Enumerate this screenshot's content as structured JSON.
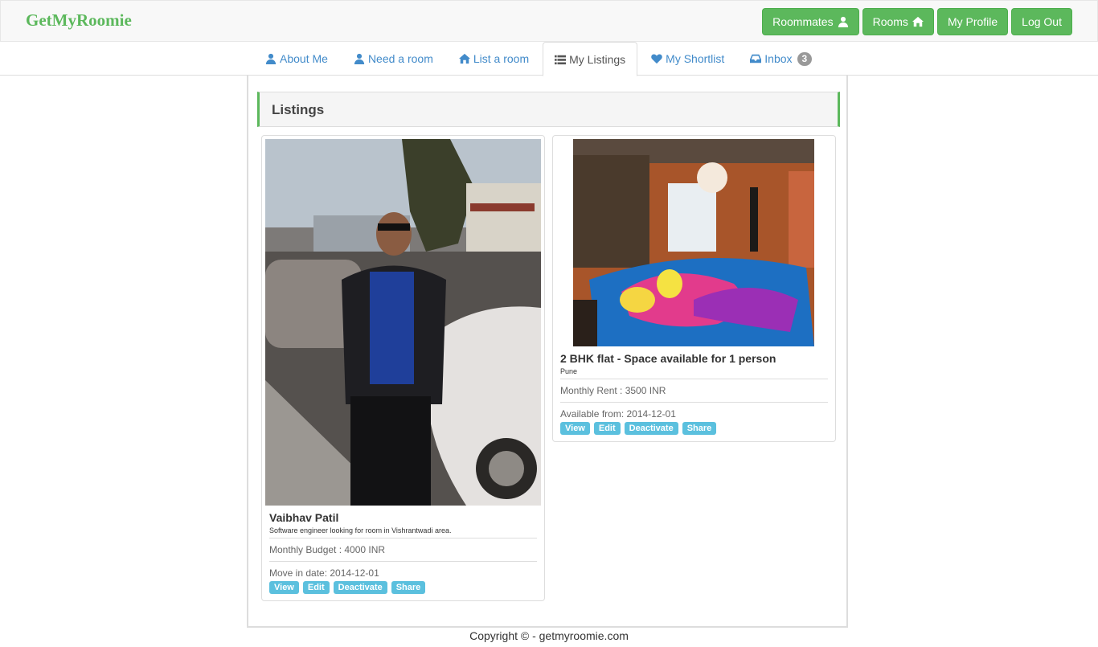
{
  "brand": "GetMyRoomie",
  "navbar": {
    "buttons": [
      {
        "label": "Roommates",
        "icon": "user-icon"
      },
      {
        "label": "Rooms",
        "icon": "home-icon"
      },
      {
        "label": "My Profile"
      },
      {
        "label": "Log Out"
      }
    ]
  },
  "tabs": [
    {
      "label": "About Me",
      "icon": "user-icon"
    },
    {
      "label": "Need a room",
      "icon": "user-icon"
    },
    {
      "label": "List a room",
      "icon": "home-icon"
    },
    {
      "label": "My Listings",
      "icon": "list-icon",
      "active": true
    },
    {
      "label": "My Shortlist",
      "icon": "heart-icon"
    },
    {
      "label": "Inbox",
      "icon": "inbox-icon",
      "badge": "3"
    }
  ],
  "listings": {
    "title": "Listings",
    "cards": [
      {
        "title": "Vaibhav Patil",
        "subtitle": "Software engineer looking for room in Vishrantwadi area.",
        "info1": "Monthly Budget : 4000 INR",
        "info2": "Move in date: 2014-12-01",
        "actions": [
          "View",
          "Edit",
          "Deactivate",
          "Share"
        ]
      },
      {
        "title": "2 BHK flat - Space available for 1 person",
        "subtitle": "Pune",
        "info1": "Monthly Rent : 3500 INR",
        "info2": "Available from: 2014-12-01",
        "actions": [
          "View",
          "Edit",
          "Deactivate",
          "Share"
        ]
      }
    ]
  },
  "footer": "Copyright © - getmyroomie.com",
  "colors": {
    "brand_green": "#5cb85c",
    "link_blue": "#428bca",
    "label_info": "#5bc0de"
  }
}
